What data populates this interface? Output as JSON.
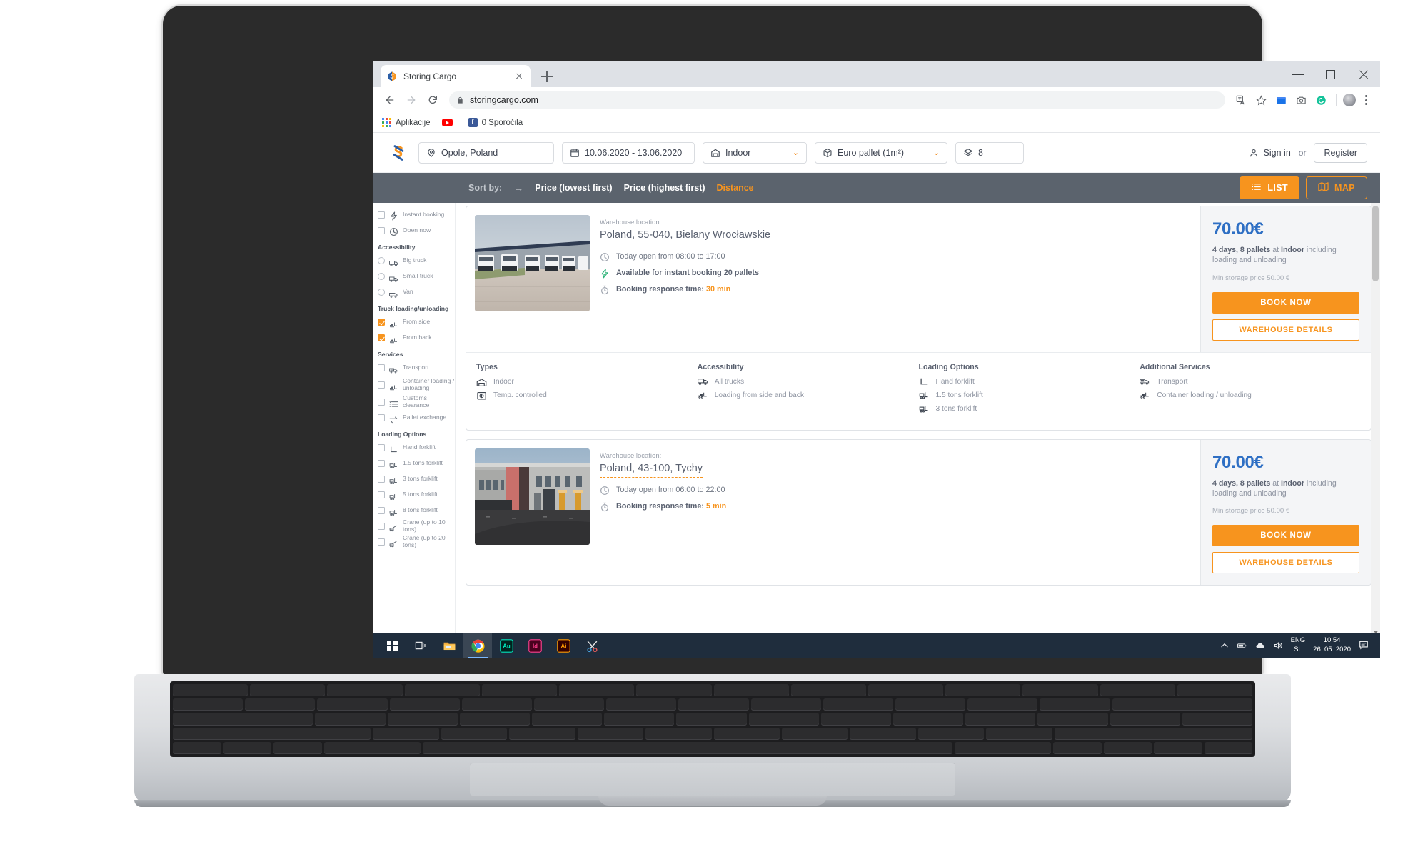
{
  "browser": {
    "tab": {
      "title": "Storing Cargo",
      "favicon": "storing-cargo-logo"
    },
    "new_tab_label": "+",
    "window_controls": {
      "minimize": "–",
      "maximize": "❐",
      "close": "✕"
    },
    "address": "storingcargo.com",
    "bookmarks": [
      {
        "label": "Aplikacije",
        "icon": "apps-grid-icon"
      },
      {
        "label": "",
        "icon": "youtube-icon"
      },
      {
        "label": "0 Sporočila",
        "icon": "facebook-icon"
      }
    ],
    "extensions": [
      "translate-icon",
      "bookmark-star-icon",
      "blue-folder-icon",
      "camera-icon",
      "grammarly-icon"
    ]
  },
  "site": {
    "logo_alt": "storing-cargo-logo",
    "search": {
      "location": {
        "value": "Opole, Poland",
        "icon": "map-pin-icon"
      },
      "dates": {
        "value": "10.06.2020 - 13.06.2020",
        "icon": "calendar-icon"
      },
      "warehouse_type": {
        "value": "Indoor",
        "icon": "warehouse-icon",
        "caret": "⌄"
      },
      "pallet_type": {
        "value": "Euro pallet (1m²)",
        "icon": "box-icon",
        "caret": "⌄"
      },
      "quantity": {
        "value": "8",
        "icon": "layers-icon"
      }
    },
    "auth": {
      "sign_in": "Sign in",
      "or": "or",
      "register": "Register"
    }
  },
  "sortbar": {
    "label": "Sort by:",
    "arrow": "→",
    "options": [
      {
        "label": "Price (lowest first)",
        "active": false
      },
      {
        "label": "Price (highest first)",
        "active": false
      },
      {
        "label": "Distance",
        "active": true
      }
    ],
    "views": [
      {
        "label": "LIST",
        "icon": "list-icon",
        "active": true
      },
      {
        "label": "MAP",
        "icon": "map-icon",
        "active": false
      }
    ]
  },
  "sidebar": {
    "top_filters": [
      {
        "label": "Instant booking",
        "icon": "bolt-icon",
        "control": "checkbox",
        "checked": false
      },
      {
        "label": "Open now",
        "icon": "clock-icon",
        "control": "checkbox",
        "checked": false
      }
    ],
    "groups": [
      {
        "title": "Accessibility",
        "items": [
          {
            "label": "Big truck",
            "icon": "big-truck-icon",
            "control": "radio",
            "checked": false
          },
          {
            "label": "Small truck",
            "icon": "small-truck-icon",
            "control": "radio",
            "checked": false
          },
          {
            "label": "Van",
            "icon": "van-icon",
            "control": "radio",
            "checked": false
          }
        ]
      },
      {
        "title": "Truck loading/unloading",
        "items": [
          {
            "label": "From side",
            "icon": "forklift-side-icon",
            "control": "checkbox",
            "checked": true
          },
          {
            "label": "From back",
            "icon": "forklift-back-icon",
            "control": "checkbox",
            "checked": true
          }
        ]
      },
      {
        "title": "Services",
        "items": [
          {
            "label": "Transport",
            "icon": "transport-truck-icon",
            "control": "checkbox",
            "checked": false
          },
          {
            "label": "Container loading / unloading",
            "icon": "container-loading-icon",
            "control": "checkbox",
            "checked": false
          },
          {
            "label": "Customs clearance",
            "icon": "customs-list-icon",
            "control": "checkbox",
            "checked": false
          },
          {
            "label": "Pallet exchange",
            "icon": "exchange-arrows-icon",
            "control": "checkbox",
            "checked": false
          }
        ]
      },
      {
        "title": "Loading Options",
        "items": [
          {
            "label": "Hand forklift",
            "icon": "hand-forklift-icon",
            "control": "checkbox",
            "checked": false
          },
          {
            "label": "1.5 tons forklift",
            "icon": "forklift-icon",
            "control": "checkbox",
            "checked": false
          },
          {
            "label": "3 tons forklift",
            "icon": "forklift-icon",
            "control": "checkbox",
            "checked": false
          },
          {
            "label": "5 tons forklift",
            "icon": "forklift-icon",
            "control": "checkbox",
            "checked": false
          },
          {
            "label": "8 tons forklift",
            "icon": "forklift-icon",
            "control": "checkbox",
            "checked": false
          },
          {
            "label": "Crane (up to 10 tons)",
            "icon": "crane-icon",
            "control": "checkbox",
            "checked": false
          },
          {
            "label": "Crane (up to 20 tons)",
            "icon": "crane-icon",
            "control": "checkbox",
            "checked": false
          }
        ]
      }
    ]
  },
  "results": [
    {
      "thumb": "warehouse-trucks-photo",
      "location_label": "Warehouse location:",
      "location": "Poland, 55-040, Bielany Wrocławskie",
      "open_hours": "Today open from 08:00 to 17:00",
      "instant": "Available for instant booking 20 pallets",
      "response_label": "Booking response time:",
      "response_value": "30 min",
      "price": "70.00€",
      "price_sub_a": "4 days, 8 pallets",
      "price_sub_b": " at ",
      "price_sub_c": "Indoor",
      "price_sub_d": " including loading and unloading",
      "min_price": "Min storage price 50.00 €",
      "book_label": "BOOK NOW",
      "details_label": "WAREHOUSE DETAILS",
      "features": [
        {
          "title": "Types",
          "items": [
            {
              "label": "Indoor",
              "icon": "warehouse-icon"
            },
            {
              "label": "Temp. controlled",
              "icon": "temperature-icon"
            }
          ]
        },
        {
          "title": "Accessibility",
          "items": [
            {
              "label": "All trucks",
              "icon": "big-truck-icon"
            },
            {
              "label": "Loading from side and back",
              "icon": "forklift-side-icon"
            }
          ]
        },
        {
          "title": "Loading Options",
          "items": [
            {
              "label": "Hand forklift",
              "icon": "hand-forklift-icon"
            },
            {
              "label": "1.5 tons forklift",
              "icon": "forklift-icon"
            },
            {
              "label": "3 tons forklift",
              "icon": "forklift-icon"
            }
          ]
        },
        {
          "title": "Additional Services",
          "items": [
            {
              "label": "Transport",
              "icon": "transport-truck-icon"
            },
            {
              "label": "Container loading / unloading",
              "icon": "container-loading-icon"
            }
          ]
        }
      ]
    },
    {
      "thumb": "warehouse-building-photo",
      "location_label": "Warehouse location:",
      "location": "Poland, 43-100, Tychy",
      "open_hours": "Today open from 06:00 to 22:00",
      "instant": null,
      "response_label": "Booking response time:",
      "response_value": "5 min",
      "price": "70.00€",
      "price_sub_a": "4 days, 8 pallets",
      "price_sub_b": " at ",
      "price_sub_c": "Indoor",
      "price_sub_d": " including loading and unloading",
      "min_price": "Min storage price 50.00 €",
      "book_label": "BOOK NOW",
      "details_label": "WAREHOUSE DETAILS",
      "features": []
    }
  ],
  "taskbar": {
    "items": [
      {
        "name": "start-button",
        "icon": "windows-logo-icon"
      },
      {
        "name": "task-view-button",
        "icon": "task-view-icon"
      },
      {
        "name": "file-explorer",
        "icon": "folder-icon"
      },
      {
        "name": "chrome",
        "icon": "chrome-icon",
        "active": true
      },
      {
        "name": "audition",
        "icon": "adobe-audition-icon",
        "label": "Au"
      },
      {
        "name": "indesign",
        "icon": "adobe-indesign-icon",
        "label": "Id"
      },
      {
        "name": "illustrator",
        "icon": "adobe-illustrator-icon",
        "label": "Ai"
      },
      {
        "name": "snipping-tool",
        "icon": "snipping-tool-icon"
      }
    ],
    "tray": {
      "lang_primary": "ENG",
      "lang_secondary": "SL",
      "time": "10:54",
      "date": "26. 05. 2020"
    }
  },
  "colors": {
    "accent": "#f7941e",
    "price": "#2e6fc4",
    "sortbar_bg": "#5b636d",
    "taskbar_bg": "#1f2d3d"
  }
}
